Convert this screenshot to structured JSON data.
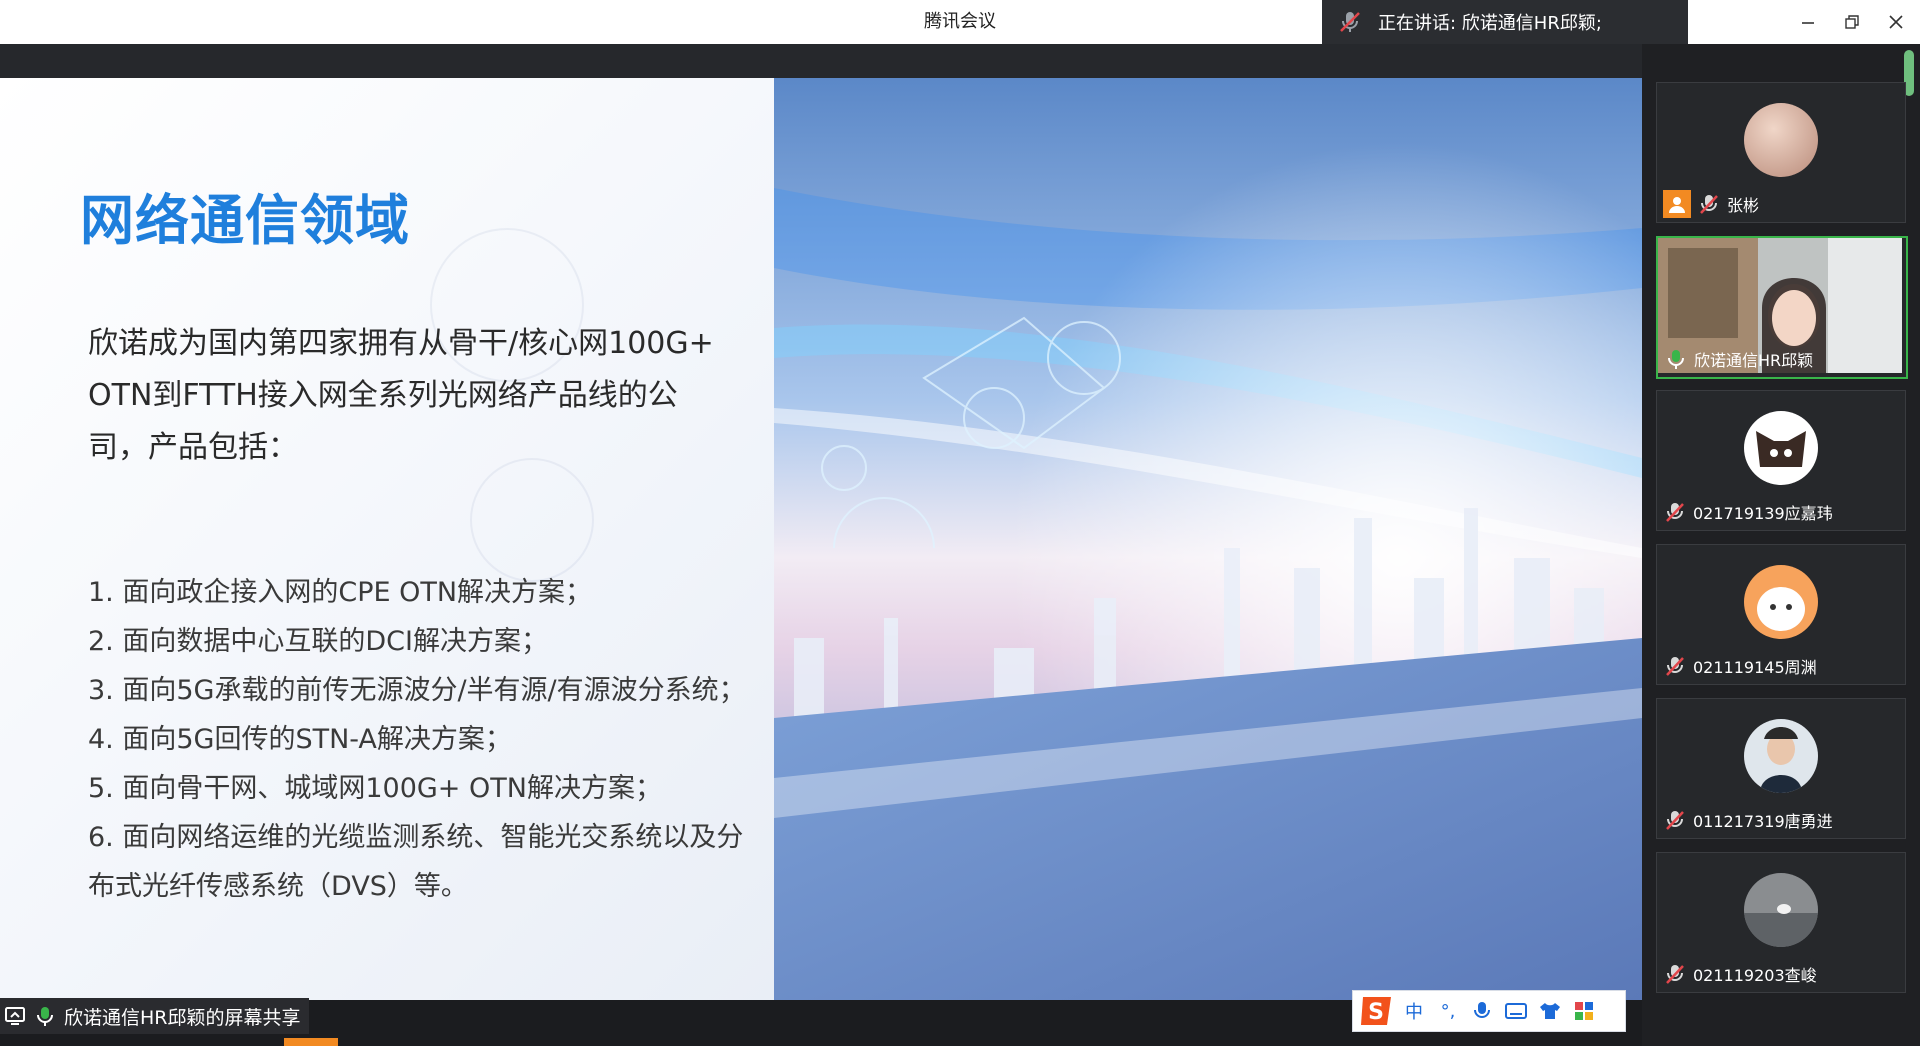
{
  "window": {
    "title": "腾讯会议"
  },
  "speaking": {
    "text": "正在讲话: 欣诺通信HR邱颖;"
  },
  "slide": {
    "title": "网络通信领域",
    "intro": "欣诺成为国内第四家拥有从骨干/核心网100G+ OTN到FTTH接入网全系列光网络产品线的公司，产品包括：",
    "items": [
      "1. 面向政企接入网的CPE OTN解决方案；",
      "2. 面向数据中心互联的DCI解决方案；",
      "3. 面向5G承载的前传无源波分/半有源/有源波分系统；",
      "4. 面向5G回传的STN-A解决方案；",
      "5. 面向骨干网、城域网100G+ OTN解决方案；",
      "6. 面向网络运维的光缆监测系统、智能光交系统以及分布式光纤传感系统（DVS）等。"
    ]
  },
  "participants": [
    {
      "name": "张彬",
      "host": true,
      "mic": "muted"
    },
    {
      "name": "欣诺通信HR邱颖",
      "host": false,
      "mic": "active",
      "video": true
    },
    {
      "name": "021719139应嘉玮",
      "host": false,
      "mic": "muted"
    },
    {
      "name": "021119145周渊",
      "host": false,
      "mic": "muted"
    },
    {
      "name": "011217319唐勇进",
      "host": false,
      "mic": "muted"
    },
    {
      "name": "021119203查峻",
      "host": false,
      "mic": "muted"
    }
  ],
  "share": {
    "label": "欣诺通信HR邱颖的屏幕共享"
  },
  "ime": {
    "lang": "中",
    "punct": "°,"
  },
  "colors": {
    "accent": "#1f7fdc",
    "active": "#39b54a",
    "muted": "#e2464b",
    "host": "#f28a22"
  }
}
